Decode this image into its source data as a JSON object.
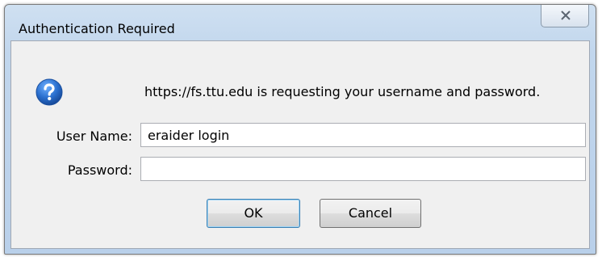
{
  "window": {
    "title": "Authentication Required",
    "close_icon": "close-x-icon"
  },
  "dialog": {
    "icon": "question-icon",
    "message": "https://fs.ttu.edu is requesting your username and password.",
    "username_label": "User Name:",
    "username_value": "eraider login",
    "password_label": "Password:",
    "password_value": "",
    "ok_label": "OK",
    "cancel_label": "Cancel"
  },
  "colors": {
    "title_bar": "#c1d6ed",
    "client_bg": "#f0f0f0",
    "icon_blue": "#2a6fce",
    "default_button_border": "#3c7fb1"
  }
}
